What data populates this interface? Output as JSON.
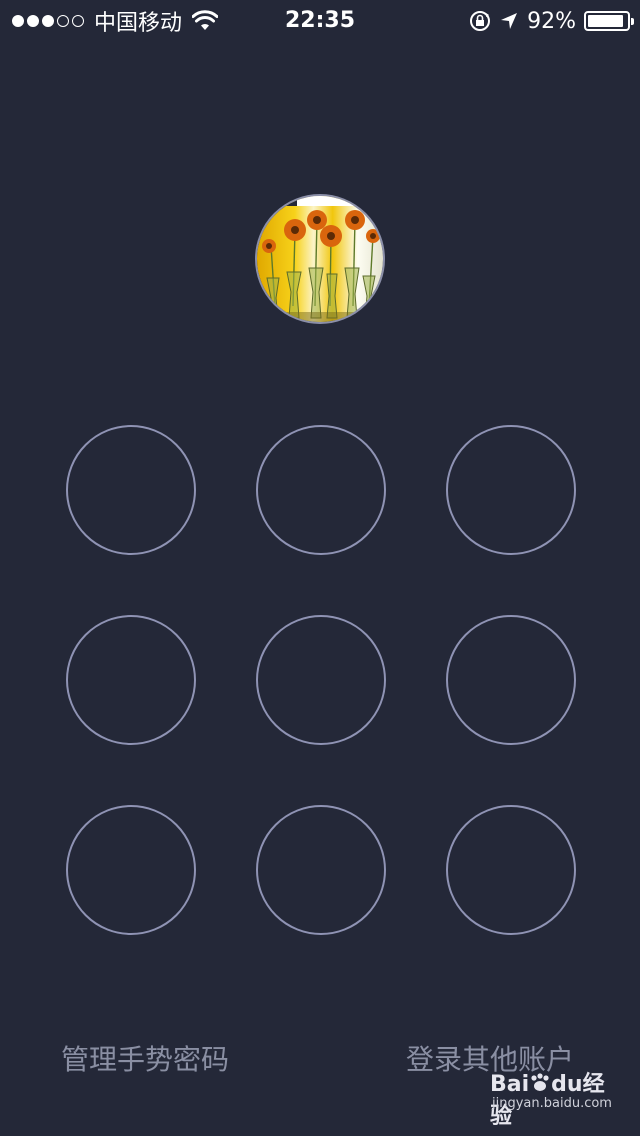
{
  "status_bar": {
    "signal_dots": [
      true,
      true,
      true,
      false,
      false
    ],
    "carrier": "中国移动",
    "time": "22:35",
    "battery_percent": "92%",
    "battery_level": 0.92,
    "icons": [
      "wifi-icon",
      "rotation-lock-icon",
      "location-arrow-icon",
      "battery-icon"
    ]
  },
  "avatar": {
    "icon": "user-avatar-sunflowers"
  },
  "gesture_grid": {
    "rows": 3,
    "cols": 3,
    "nodes": [
      "1",
      "2",
      "3",
      "4",
      "5",
      "6",
      "7",
      "8",
      "9"
    ]
  },
  "footer": {
    "manage_label": "管理手势密码",
    "other_account_label": "登录其他账户"
  },
  "watermark": {
    "brand": "Bai",
    "brand_du": "du",
    "brand_suffix": "经验",
    "url": "jingyan.baidu.com"
  },
  "colors": {
    "background": "#242838",
    "node_border": "#8f93b4",
    "footer_text": "#8a8fa3"
  }
}
